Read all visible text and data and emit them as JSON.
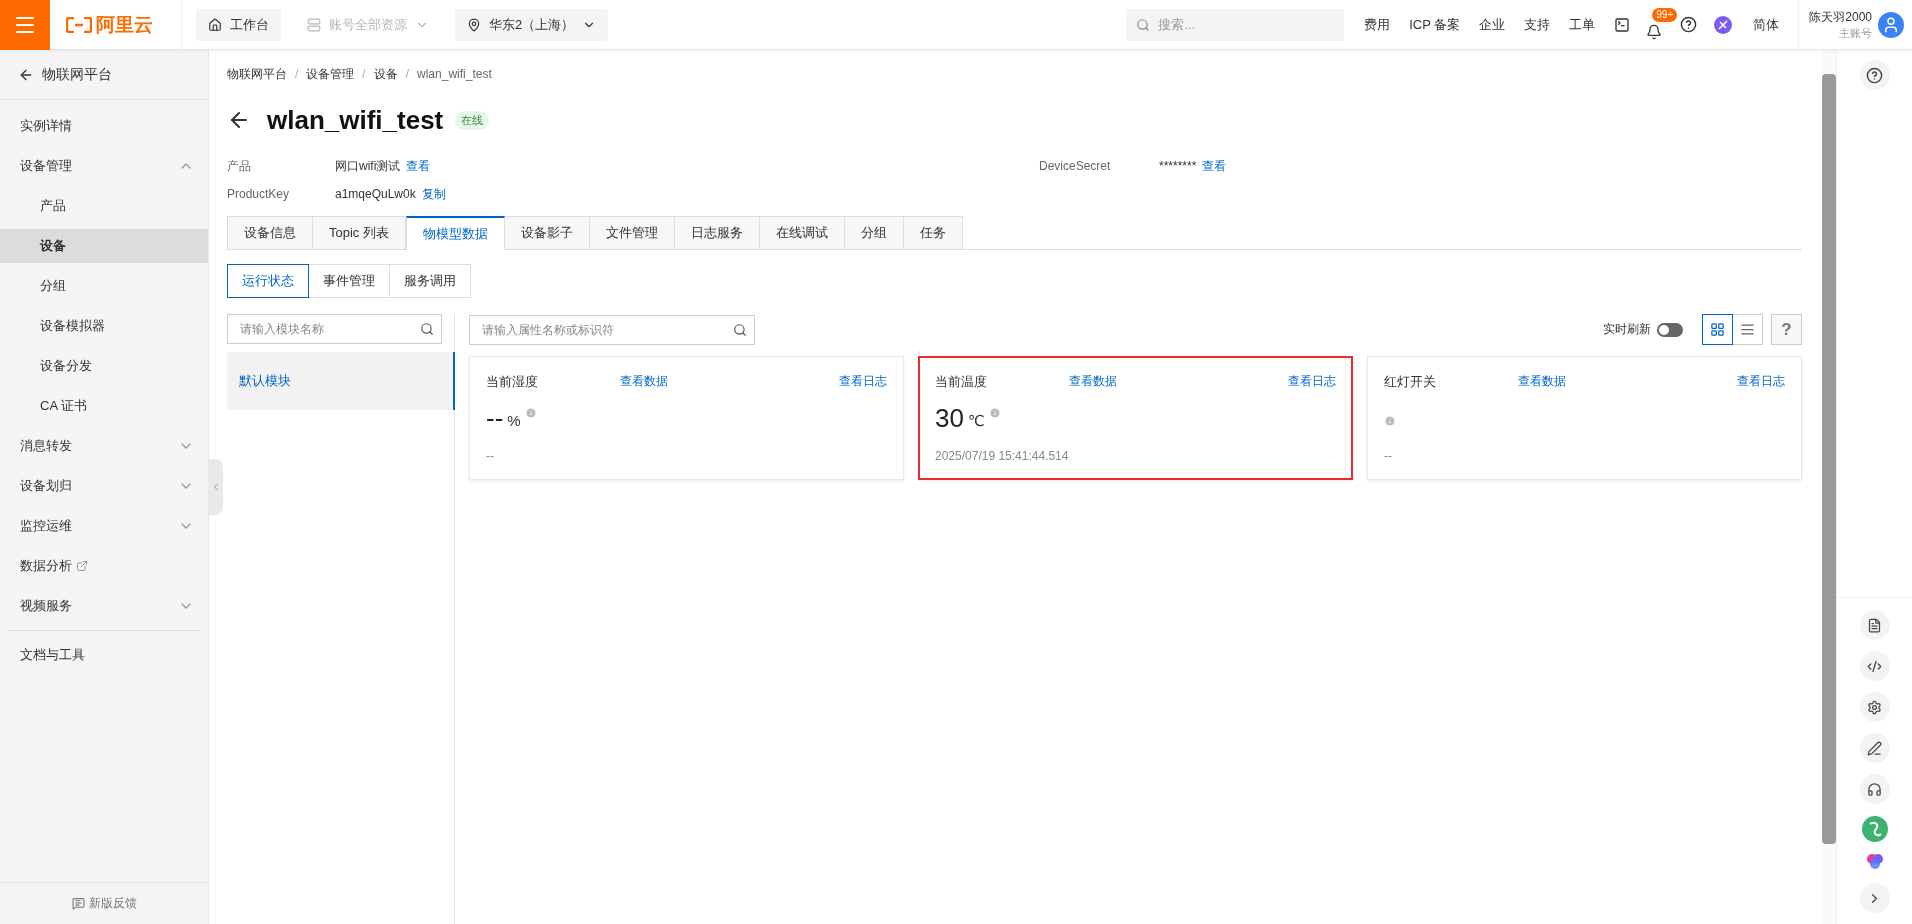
{
  "topbar": {
    "brand": "阿里云",
    "nav": [
      {
        "kind": "home",
        "label": "工作台",
        "disabled": false,
        "dropdown": false
      },
      {
        "kind": "resources",
        "label": "账号全部资源",
        "disabled": true,
        "dropdown": true
      },
      {
        "kind": "region",
        "label": "华东2（上海）",
        "disabled": false,
        "dropdown": true
      }
    ],
    "search": {
      "placeholder": "搜索..."
    },
    "links": [
      "费用",
      "ICP 备案",
      "企业",
      "支持",
      "工单"
    ],
    "badge": "99+",
    "language": "简体",
    "user": {
      "name": "陈天羽2000",
      "role": "主账号"
    }
  },
  "sidebar": {
    "back": "物联网平台",
    "items": [
      {
        "label": "实例详情",
        "kind": "link",
        "selected": false
      },
      {
        "label": "设备管理",
        "kind": "group",
        "expanded": true,
        "selected": false,
        "children": [
          {
            "label": "产品",
            "selected": false
          },
          {
            "label": "设备",
            "selected": true
          },
          {
            "label": "分组",
            "selected": false
          },
          {
            "label": "设备模拟器",
            "selected": false
          },
          {
            "label": "设备分发",
            "selected": false
          },
          {
            "label": "CA 证书",
            "selected": false
          }
        ]
      },
      {
        "label": "消息转发",
        "kind": "group",
        "expanded": false,
        "selected": false
      },
      {
        "label": "设备划归",
        "kind": "group",
        "expanded": false,
        "selected": false
      },
      {
        "label": "监控运维",
        "kind": "group",
        "expanded": false,
        "selected": false
      },
      {
        "label": "数据分析",
        "kind": "external",
        "selected": false
      },
      {
        "label": "视频服务",
        "kind": "group",
        "expanded": false,
        "selected": false
      }
    ],
    "tools": [
      {
        "label": "文档与工具",
        "selected": false
      }
    ],
    "feedback": "新版反馈"
  },
  "main": {
    "breadcrumb": [
      {
        "label": "物联网平台"
      },
      {
        "separator": "/",
        "label": "设备管理"
      },
      {
        "separator": "/",
        "label": "设备"
      },
      {
        "separator": "/",
        "label": "wlan_wifi_test"
      }
    ],
    "title": "wlan_wifi_test",
    "status": "在线",
    "info_left": [
      {
        "label": "产品",
        "value": "网口wifi测试",
        "action": "查看"
      },
      {
        "label": "ProductKey",
        "value": "a1mqeQuLw0k",
        "action": "复制"
      }
    ],
    "info_right": [
      {
        "label": "DeviceSecret",
        "value": "********",
        "action": "查看"
      }
    ],
    "tabs": [
      {
        "label": "设备信息",
        "selected": false
      },
      {
        "label": "Topic 列表",
        "selected": false
      },
      {
        "label": "物模型数据",
        "selected": true
      },
      {
        "label": "设备影子",
        "selected": false
      },
      {
        "label": "文件管理",
        "selected": false
      },
      {
        "label": "日志服务",
        "selected": false
      },
      {
        "label": "在线调试",
        "selected": false
      },
      {
        "label": "分组",
        "selected": false
      },
      {
        "label": "任务",
        "selected": false
      }
    ],
    "subtabs": [
      {
        "label": "运行状态",
        "selected": true
      },
      {
        "label": "事件管理",
        "selected": false
      },
      {
        "label": "服务调用",
        "selected": false
      }
    ],
    "module_search": {
      "placeholder": "请输入模块名称"
    },
    "modules": [
      {
        "label": "默认模块",
        "selected": true
      }
    ],
    "property_search": {
      "placeholder": "请输入属性名称或标识符"
    },
    "realtime": {
      "label": "实时刷新",
      "on": false
    },
    "views": [
      {
        "kind": "grid",
        "selected": true
      },
      {
        "kind": "list",
        "selected": false
      }
    ],
    "help_button": "?",
    "cards": [
      {
        "name": "当前湿度",
        "data_link": "查看数据",
        "log_link": "查看日志",
        "value": "--",
        "unit": "%",
        "time": "--",
        "selected": false
      },
      {
        "name": "当前温度",
        "data_link": "查看数据",
        "log_link": "查看日志",
        "value": "30",
        "unit": "℃",
        "time": "2025/07/19 15:41:44.514",
        "selected": true
      },
      {
        "name": "红灯开关",
        "data_link": "查看数据",
        "log_link": "查看日志",
        "time": "--",
        "selected": false
      }
    ]
  }
}
